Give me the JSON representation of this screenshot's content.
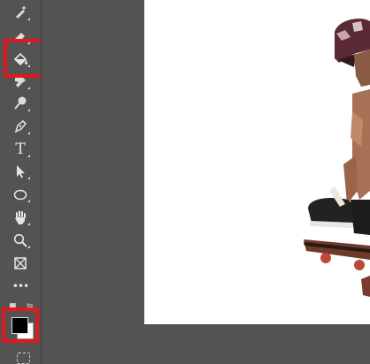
{
  "toolbar": {
    "tools": [
      {
        "name": "healing-brush-tool",
        "icon": "bandage-sparkle-icon"
      },
      {
        "name": "eraser-tool",
        "icon": "eraser-icon"
      },
      {
        "name": "paint-bucket-tool",
        "icon": "paint-bucket-icon",
        "highlighted": true
      },
      {
        "name": "smudge-tool",
        "icon": "smudge-finger-icon"
      },
      {
        "name": "dodge-tool",
        "icon": "dodge-icon"
      },
      {
        "name": "pen-tool",
        "icon": "pen-icon"
      },
      {
        "name": "type-tool",
        "icon": "type-icon",
        "label": "T"
      },
      {
        "name": "path-selection-tool",
        "icon": "arrow-cursor-icon"
      },
      {
        "name": "ellipse-tool",
        "icon": "ellipse-icon"
      },
      {
        "name": "hand-tool",
        "icon": "hand-icon"
      },
      {
        "name": "zoom-tool",
        "icon": "magnifier-icon"
      },
      {
        "name": "frame-tool",
        "icon": "frame-icon"
      },
      {
        "name": "edit-toolbar",
        "icon": "ellipsis-icon",
        "label": "•••"
      }
    ],
    "colors": {
      "foreground": "#000000",
      "background": "#ffffff",
      "foreground_highlighted": true
    }
  },
  "theme": {
    "panel": "#535353",
    "highlight": "#e0191e",
    "canvas": "#ffffff"
  }
}
